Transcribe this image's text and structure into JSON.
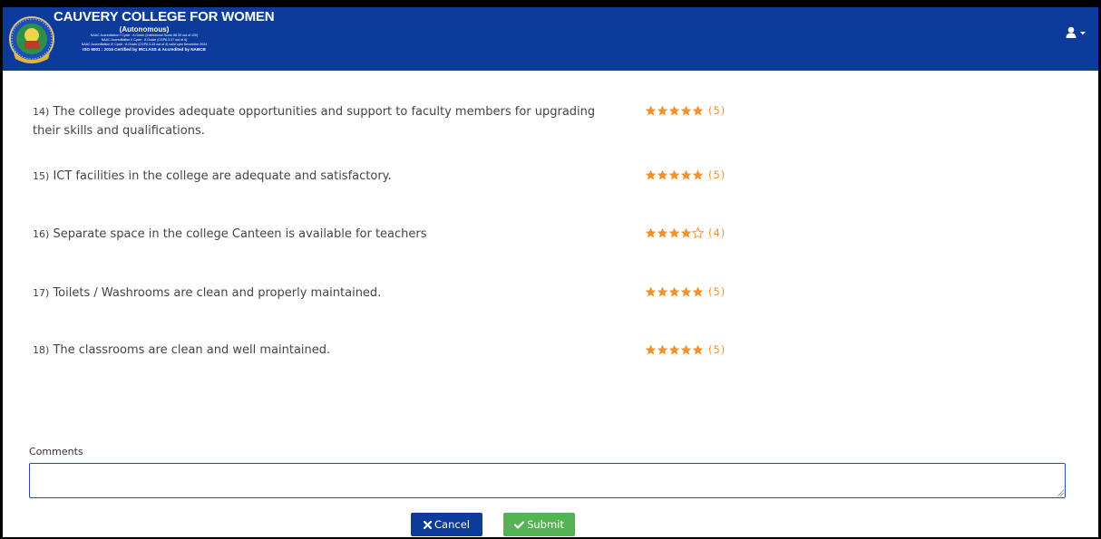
{
  "header": {
    "college_name": "CAUVERY COLLEGE FOR WOMEN",
    "subtitle": "(Autonomous)",
    "accreditation_lines": [
      "NAAC Accreditation I Cycle : A Grade (Institutional Score 88.35 out of 100)",
      "NAAC Accreditation II Cycle : A Grade (CGPA 3.37 out of 4)",
      "NAAC Accreditation III Cycle : A Grade (CGPA 3.43 out of 4) valid upto December 2024"
    ],
    "iso_line": "ISO 9001 : 2015 Certified by IRCLASS & Accredited by NABCB"
  },
  "questions": [
    {
      "text": "The college provides adequate opportunities and support to faculty members for upgrading their skills and qualifications.",
      "number": "14)",
      "rating": 5,
      "rating_label": "(5)"
    },
    {
      "text": "ICT facilities in the college are adequate and satisfactory.",
      "number": "15)",
      "rating": 5,
      "rating_label": "(5)"
    },
    {
      "text": "Separate space in the college Canteen is available for teachers",
      "number": "16)",
      "rating": 4,
      "rating_label": "(4)"
    },
    {
      "text": "Toilets / Washrooms are clean and properly maintained.",
      "number": "17)",
      "rating": 5,
      "rating_label": "(5)"
    },
    {
      "text": "The classrooms are clean and well maintained.",
      "number": "18)",
      "rating": 5,
      "rating_label": "(5)"
    }
  ],
  "comments": {
    "label": "Comments",
    "value": ""
  },
  "buttons": {
    "cancel": "Cancel",
    "submit": "Submit"
  },
  "colors": {
    "header": "#0d3b9b",
    "star": "#f0932f",
    "cancel": "#0d3b9b",
    "submit": "#54b352"
  },
  "icons": {
    "user": "user-icon",
    "caret": "caret-down-icon",
    "star": "star-icon",
    "cancel": "times-icon",
    "submit": "check-icon"
  }
}
